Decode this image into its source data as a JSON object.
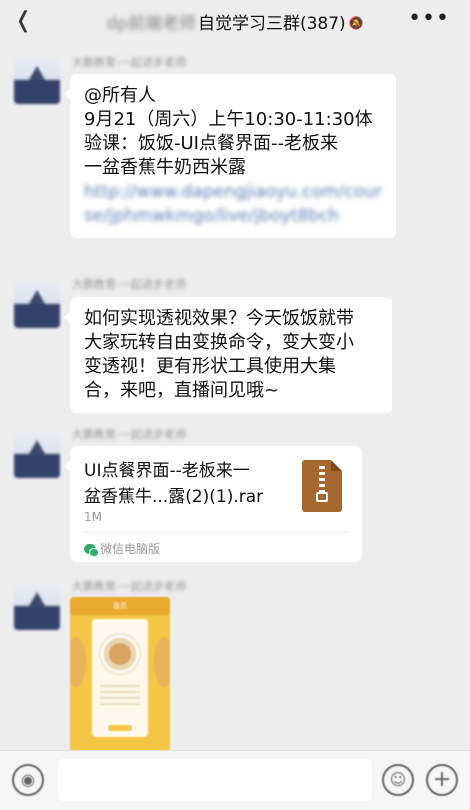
{
  "header": {
    "back_icon": "chevron-left-icon",
    "title_blurred": "dp前端老师",
    "title": "自觉学习三群(387)",
    "mute_icon": "bell-slash-icon",
    "more_icon": "more-dots-icon"
  },
  "messages": [
    {
      "sender": "大鹏教育-一起进步老师",
      "lines": [
        "@所有人",
        "9月21（周六）上午10:30-11:30体",
        "验课：饭饭-UI点餐界面--老板来",
        "一盆香蕉牛奶西米露"
      ],
      "link": "http://www.dapengjiaoyu.com/course/jphmwkmgo/live/jboyt8bch"
    },
    {
      "sender": "大鹏教育-一起进步老师",
      "lines": [
        "如何实现透视效果？今天饭饭就带",
        "大家玩转自由变换命令，变大变小",
        "变透视！更有形状工具使用大集",
        "合，来吧，直播间见哦~"
      ]
    },
    {
      "sender": "大鹏教育-一起进步老师",
      "file": {
        "name_line1": "UI点餐界面--老板来一",
        "name_line2": "盆香蕉牛...露(2)(1).rar",
        "size": "1M",
        "source": "微信电脑版",
        "icon": "zip-archive-icon"
      }
    },
    {
      "sender": "大鹏教育-一起进步老师",
      "image": {
        "title": "首页"
      }
    }
  ],
  "footer": {
    "voice_icon": "voice-icon",
    "emoji_icon": "emoji-icon",
    "plus_icon": "plus-icon"
  }
}
